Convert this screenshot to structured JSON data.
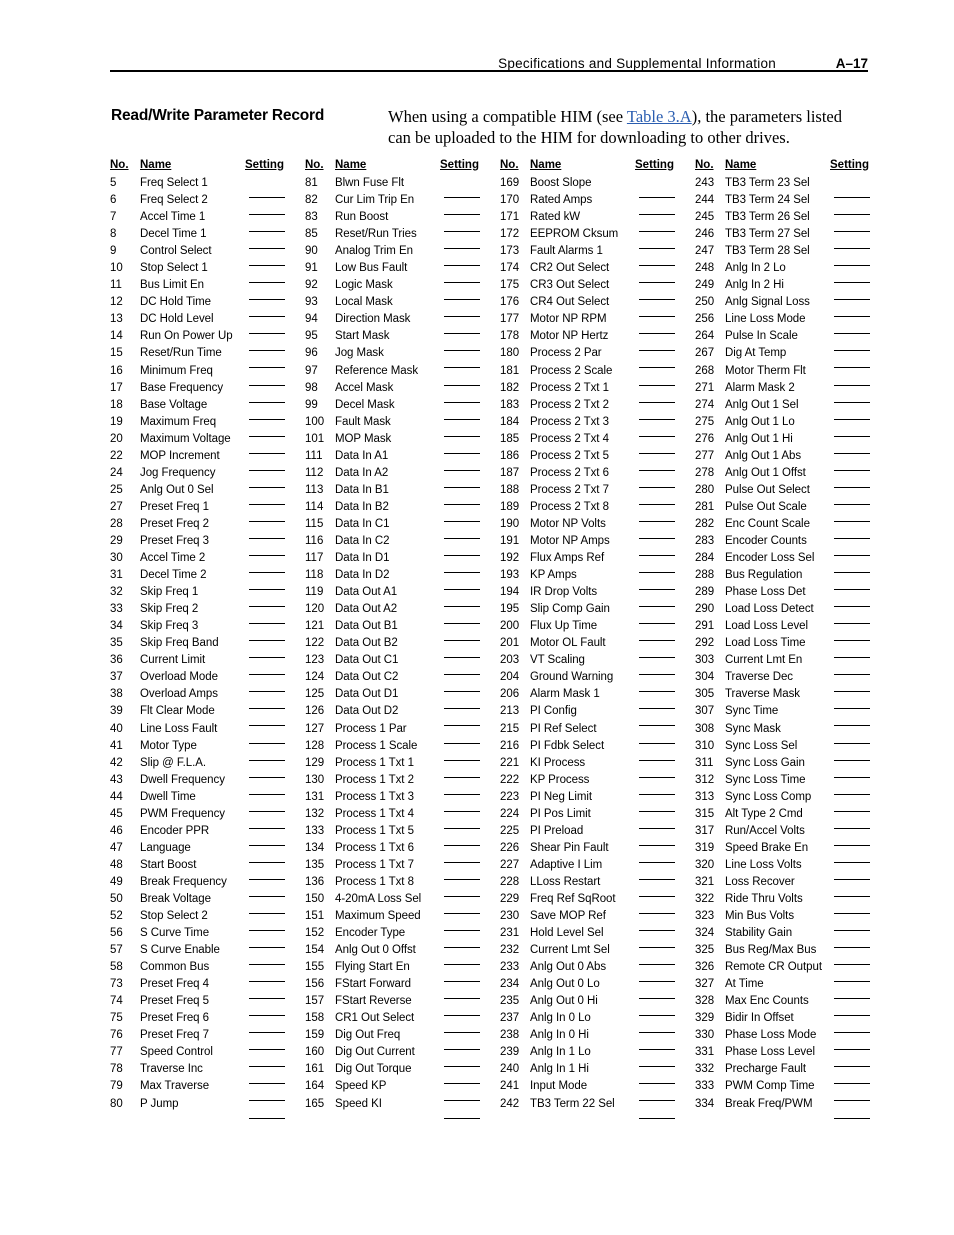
{
  "header": {
    "title": "Specifications and Supplemental Information",
    "page_number": "A–17"
  },
  "section": {
    "title": "Read/Write Parameter Record",
    "intro_before_link": "When using a compatible HIM (see ",
    "intro_link": "Table 3.A",
    "intro_after_link": "), the parameters listed can be uploaded to the HIM for downloading to other drives."
  },
  "table": {
    "headers": {
      "no": "No.",
      "name": "Name",
      "setting": "Setting"
    },
    "columns": [
      {
        "rows": [
          {
            "no": "5",
            "name": "Freq Select 1"
          },
          {
            "no": "6",
            "name": "Freq Select 2"
          },
          {
            "no": "7",
            "name": "Accel Time 1"
          },
          {
            "no": "8",
            "name": "Decel Time 1"
          },
          {
            "no": "9",
            "name": "Control Select"
          },
          {
            "no": "10",
            "name": "Stop Select 1"
          },
          {
            "no": "11",
            "name": "Bus Limit En"
          },
          {
            "no": "12",
            "name": "DC Hold Time"
          },
          {
            "no": "13",
            "name": "DC Hold Level"
          },
          {
            "no": "14",
            "name": "Run On Power Up"
          },
          {
            "no": "15",
            "name": "Reset/Run Time"
          },
          {
            "no": "16",
            "name": "Minimum Freq"
          },
          {
            "no": "17",
            "name": "Base Frequency"
          },
          {
            "no": "18",
            "name": "Base Voltage"
          },
          {
            "no": "19",
            "name": "Maximum Freq"
          },
          {
            "no": "20",
            "name": "Maximum Voltage"
          },
          {
            "no": "22",
            "name": "MOP Increment"
          },
          {
            "no": "24",
            "name": "Jog Frequency"
          },
          {
            "no": "25",
            "name": "Anlg Out 0 Sel"
          },
          {
            "no": "27",
            "name": "Preset Freq 1"
          },
          {
            "no": "28",
            "name": "Preset Freq 2"
          },
          {
            "no": "29",
            "name": "Preset Freq 3"
          },
          {
            "no": "30",
            "name": "Accel Time 2"
          },
          {
            "no": "31",
            "name": "Decel Time 2"
          },
          {
            "no": "32",
            "name": "Skip Freq 1"
          },
          {
            "no": "33",
            "name": "Skip Freq 2"
          },
          {
            "no": "34",
            "name": "Skip Freq 3"
          },
          {
            "no": "35",
            "name": "Skip Freq Band"
          },
          {
            "no": "36",
            "name": "Current Limit"
          },
          {
            "no": "37",
            "name": "Overload Mode"
          },
          {
            "no": "38",
            "name": "Overload Amps"
          },
          {
            "no": "39",
            "name": "Flt Clear Mode"
          },
          {
            "no": "40",
            "name": "Line Loss Fault"
          },
          {
            "no": "41",
            "name": "Motor Type"
          },
          {
            "no": "42",
            "name": "Slip @ F.L.A."
          },
          {
            "no": "43",
            "name": "Dwell Frequency"
          },
          {
            "no": "44",
            "name": "Dwell Time"
          },
          {
            "no": "45",
            "name": "PWM Frequency"
          },
          {
            "no": "46",
            "name": "Encoder PPR"
          },
          {
            "no": "47",
            "name": "Language"
          },
          {
            "no": "48",
            "name": "Start Boost"
          },
          {
            "no": "49",
            "name": "Break Frequency"
          },
          {
            "no": "50",
            "name": "Break Voltage"
          },
          {
            "no": "52",
            "name": "Stop Select 2"
          },
          {
            "no": "56",
            "name": "S Curve Time"
          },
          {
            "no": "57",
            "name": "S Curve Enable"
          },
          {
            "no": "58",
            "name": "Common Bus"
          },
          {
            "no": "73",
            "name": "Preset Freq 4"
          },
          {
            "no": "74",
            "name": "Preset Freq 5"
          },
          {
            "no": "75",
            "name": "Preset Freq 6"
          },
          {
            "no": "76",
            "name": "Preset Freq 7"
          },
          {
            "no": "77",
            "name": "Speed Control"
          },
          {
            "no": "78",
            "name": "Traverse Inc"
          },
          {
            "no": "79",
            "name": "Max Traverse"
          },
          {
            "no": "80",
            "name": "P Jump"
          }
        ]
      },
      {
        "rows": [
          {
            "no": "81",
            "name": "Blwn Fuse Flt"
          },
          {
            "no": "82",
            "name": "Cur Lim Trip En"
          },
          {
            "no": "83",
            "name": "Run Boost"
          },
          {
            "no": "85",
            "name": "Reset/Run Tries"
          },
          {
            "no": "90",
            "name": "Analog Trim En"
          },
          {
            "no": "91",
            "name": "Low Bus Fault"
          },
          {
            "no": "92",
            "name": "Logic Mask"
          },
          {
            "no": "93",
            "name": "Local Mask"
          },
          {
            "no": "94",
            "name": "Direction Mask"
          },
          {
            "no": "95",
            "name": "Start Mask"
          },
          {
            "no": "96",
            "name": "Jog Mask"
          },
          {
            "no": "97",
            "name": "Reference Mask"
          },
          {
            "no": "98",
            "name": "Accel Mask"
          },
          {
            "no": "99",
            "name": "Decel Mask"
          },
          {
            "no": "100",
            "name": "Fault Mask"
          },
          {
            "no": "101",
            "name": "MOP Mask"
          },
          {
            "no": "111",
            "name": "Data In A1"
          },
          {
            "no": "112",
            "name": "Data In A2"
          },
          {
            "no": "113",
            "name": "Data In B1"
          },
          {
            "no": "114",
            "name": "Data In B2"
          },
          {
            "no": "115",
            "name": "Data In C1"
          },
          {
            "no": "116",
            "name": "Data In C2"
          },
          {
            "no": "117",
            "name": "Data In D1"
          },
          {
            "no": "118",
            "name": "Data In D2"
          },
          {
            "no": "119",
            "name": "Data Out A1"
          },
          {
            "no": "120",
            "name": "Data Out A2"
          },
          {
            "no": "121",
            "name": "Data Out B1"
          },
          {
            "no": "122",
            "name": "Data Out B2"
          },
          {
            "no": "123",
            "name": "Data Out C1"
          },
          {
            "no": "124",
            "name": "Data Out C2"
          },
          {
            "no": "125",
            "name": "Data Out D1"
          },
          {
            "no": "126",
            "name": "Data Out D2"
          },
          {
            "no": "127",
            "name": "Process 1 Par"
          },
          {
            "no": "128",
            "name": "Process 1 Scale"
          },
          {
            "no": "129",
            "name": "Process 1 Txt 1"
          },
          {
            "no": "130",
            "name": "Process 1 Txt 2"
          },
          {
            "no": "131",
            "name": "Process 1 Txt 3"
          },
          {
            "no": "132",
            "name": "Process 1 Txt 4"
          },
          {
            "no": "133",
            "name": "Process 1 Txt 5"
          },
          {
            "no": "134",
            "name": "Process 1 Txt 6"
          },
          {
            "no": "135",
            "name": "Process 1 Txt 7"
          },
          {
            "no": "136",
            "name": "Process 1 Txt 8"
          },
          {
            "no": "150",
            "name": "4-20mA Loss Sel"
          },
          {
            "no": "151",
            "name": "Maximum Speed"
          },
          {
            "no": "152",
            "name": "Encoder Type"
          },
          {
            "no": "154",
            "name": "Anlg Out 0 Offst"
          },
          {
            "no": "155",
            "name": "Flying Start En"
          },
          {
            "no": "156",
            "name": "FStart Forward"
          },
          {
            "no": "157",
            "name": "FStart Reverse"
          },
          {
            "no": "158",
            "name": "CR1 Out Select"
          },
          {
            "no": "159",
            "name": "Dig Out Freq"
          },
          {
            "no": "160",
            "name": "Dig Out Current"
          },
          {
            "no": "161",
            "name": "Dig Out Torque"
          },
          {
            "no": "164",
            "name": "Speed KP"
          },
          {
            "no": "165",
            "name": "Speed KI"
          }
        ]
      },
      {
        "rows": [
          {
            "no": "169",
            "name": "Boost Slope"
          },
          {
            "no": "170",
            "name": "Rated Amps"
          },
          {
            "no": "171",
            "name": "Rated kW"
          },
          {
            "no": "172",
            "name": "EEPROM Cksum"
          },
          {
            "no": "173",
            "name": "Fault Alarms 1"
          },
          {
            "no": "174",
            "name": "CR2 Out Select"
          },
          {
            "no": "175",
            "name": "CR3 Out Select"
          },
          {
            "no": "176",
            "name": "CR4 Out Select"
          },
          {
            "no": "177",
            "name": "Motor NP RPM"
          },
          {
            "no": "178",
            "name": "Motor NP Hertz"
          },
          {
            "no": "180",
            "name": "Process 2 Par"
          },
          {
            "no": "181",
            "name": "Process 2 Scale"
          },
          {
            "no": "182",
            "name": "Process 2 Txt 1"
          },
          {
            "no": "183",
            "name": "Process 2 Txt 2"
          },
          {
            "no": "184",
            "name": "Process 2 Txt 3"
          },
          {
            "no": "185",
            "name": "Process 2 Txt 4"
          },
          {
            "no": "186",
            "name": "Process 2 Txt 5"
          },
          {
            "no": "187",
            "name": "Process 2 Txt 6"
          },
          {
            "no": "188",
            "name": "Process 2 Txt 7"
          },
          {
            "no": "189",
            "name": "Process 2 Txt 8"
          },
          {
            "no": "190",
            "name": "Motor NP Volts"
          },
          {
            "no": "191",
            "name": "Motor NP Amps"
          },
          {
            "no": "192",
            "name": "Flux Amps Ref"
          },
          {
            "no": "193",
            "name": "KP Amps"
          },
          {
            "no": "194",
            "name": "IR Drop Volts"
          },
          {
            "no": "195",
            "name": "Slip Comp Gain"
          },
          {
            "no": "200",
            "name": "Flux Up Time"
          },
          {
            "no": "201",
            "name": "Motor OL Fault"
          },
          {
            "no": "203",
            "name": "VT Scaling"
          },
          {
            "no": "204",
            "name": "Ground Warning"
          },
          {
            "no": "206",
            "name": "Alarm Mask 1"
          },
          {
            "no": "213",
            "name": "PI Config"
          },
          {
            "no": "215",
            "name": "PI Ref Select"
          },
          {
            "no": "216",
            "name": "PI Fdbk Select"
          },
          {
            "no": "221",
            "name": "KI Process"
          },
          {
            "no": "222",
            "name": "KP Process"
          },
          {
            "no": "223",
            "name": "PI Neg Limit"
          },
          {
            "no": "224",
            "name": "PI Pos Limit"
          },
          {
            "no": "225",
            "name": "PI Preload"
          },
          {
            "no": "226",
            "name": "Shear Pin Fault"
          },
          {
            "no": "227",
            "name": "Adaptive I Lim"
          },
          {
            "no": "228",
            "name": "LLoss Restart"
          },
          {
            "no": "229",
            "name": "Freq Ref SqRoot"
          },
          {
            "no": "230",
            "name": "Save MOP Ref"
          },
          {
            "no": "231",
            "name": "Hold Level Sel"
          },
          {
            "no": "232",
            "name": "Current Lmt Sel"
          },
          {
            "no": "233",
            "name": "Anlg Out 0 Abs"
          },
          {
            "no": "234",
            "name": "Anlg Out 0 Lo"
          },
          {
            "no": "235",
            "name": "Anlg Out 0 Hi"
          },
          {
            "no": "237",
            "name": "Anlg In 0 Lo"
          },
          {
            "no": "238",
            "name": "Anlg In 0 Hi"
          },
          {
            "no": "239",
            "name": "Anlg In 1 Lo"
          },
          {
            "no": "240",
            "name": "Anlg In 1 Hi"
          },
          {
            "no": "241",
            "name": "Input Mode"
          },
          {
            "no": "242",
            "name": "TB3 Term 22 Sel"
          }
        ]
      },
      {
        "rows": [
          {
            "no": "243",
            "name": "TB3 Term 23 Sel"
          },
          {
            "no": "244",
            "name": "TB3 Term 24 Sel"
          },
          {
            "no": "245",
            "name": "TB3 Term 26 Sel"
          },
          {
            "no": "246",
            "name": "TB3 Term 27 Sel"
          },
          {
            "no": "247",
            "name": "TB3 Term 28 Sel"
          },
          {
            "no": "248",
            "name": "Anlg In 2 Lo"
          },
          {
            "no": "249",
            "name": "Anlg In 2 Hi"
          },
          {
            "no": "250",
            "name": "Anlg Signal Loss"
          },
          {
            "no": "256",
            "name": "Line Loss Mode"
          },
          {
            "no": "264",
            "name": "Pulse In Scale"
          },
          {
            "no": "267",
            "name": "Dig At Temp"
          },
          {
            "no": "268",
            "name": "Motor Therm Flt"
          },
          {
            "no": "271",
            "name": "Alarm Mask 2"
          },
          {
            "no": "274",
            "name": "Anlg Out 1 Sel"
          },
          {
            "no": "275",
            "name": "Anlg Out 1 Lo"
          },
          {
            "no": "276",
            "name": "Anlg Out 1 Hi"
          },
          {
            "no": "277",
            "name": "Anlg Out 1 Abs"
          },
          {
            "no": "278",
            "name": "Anlg Out 1 Offst"
          },
          {
            "no": "280",
            "name": "Pulse Out Select"
          },
          {
            "no": "281",
            "name": "Pulse Out Scale"
          },
          {
            "no": "282",
            "name": "Enc Count Scale"
          },
          {
            "no": "283",
            "name": "Encoder Counts"
          },
          {
            "no": "284",
            "name": "Encoder Loss Sel"
          },
          {
            "no": "288",
            "name": "Bus Regulation"
          },
          {
            "no": "289",
            "name": "Phase Loss Det"
          },
          {
            "no": "290",
            "name": "Load Loss Detect"
          },
          {
            "no": "291",
            "name": "Load Loss Level"
          },
          {
            "no": "292",
            "name": "Load Loss Time"
          },
          {
            "no": "303",
            "name": "Current Lmt En"
          },
          {
            "no": "304",
            "name": "Traverse Dec"
          },
          {
            "no": "305",
            "name": "Traverse Mask"
          },
          {
            "no": "307",
            "name": "Sync Time"
          },
          {
            "no": "308",
            "name": "Sync Mask"
          },
          {
            "no": "310",
            "name": "Sync Loss Sel"
          },
          {
            "no": "311",
            "name": "Sync Loss Gain"
          },
          {
            "no": "312",
            "name": "Sync Loss Time"
          },
          {
            "no": "313",
            "name": "Sync Loss Comp"
          },
          {
            "no": "315",
            "name": "Alt Type 2 Cmd"
          },
          {
            "no": "317",
            "name": "Run/Accel Volts"
          },
          {
            "no": "319",
            "name": "Speed Brake En"
          },
          {
            "no": "320",
            "name": "Line Loss Volts"
          },
          {
            "no": "321",
            "name": "Loss Recover"
          },
          {
            "no": "322",
            "name": "Ride Thru Volts"
          },
          {
            "no": "323",
            "name": "Min Bus Volts"
          },
          {
            "no": "324",
            "name": "Stability Gain"
          },
          {
            "no": "325",
            "name": "Bus Reg/Max Bus"
          },
          {
            "no": "326",
            "name": "Remote CR Output"
          },
          {
            "no": "327",
            "name": "At Time"
          },
          {
            "no": "328",
            "name": "Max Enc Counts"
          },
          {
            "no": "329",
            "name": "Bidir In Offset"
          },
          {
            "no": "330",
            "name": "Phase Loss Mode"
          },
          {
            "no": "331",
            "name": "Phase Loss Level"
          },
          {
            "no": "332",
            "name": "Precharge Fault"
          },
          {
            "no": "333",
            "name": "PWM Comp Time"
          },
          {
            "no": "334",
            "name": "Break Freq/PWM"
          }
        ]
      }
    ]
  }
}
